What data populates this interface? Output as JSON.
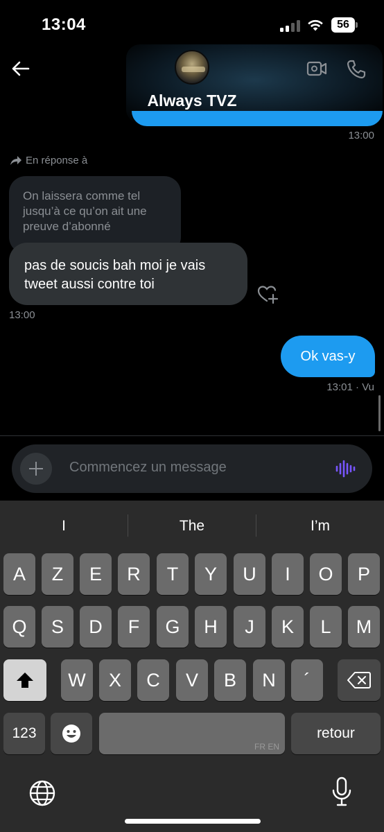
{
  "status_bar": {
    "time": "13:04",
    "battery": "56"
  },
  "header": {
    "contact_name": "Always TVZ"
  },
  "chat": {
    "timestamp_1": "13:00",
    "reply_label": "En réponse à",
    "quoted_text": "On laissera comme tel jusqu’à ce qu’on ait une preuve d’abonné",
    "incoming_text": "pas de soucis bah moi je vais tweet aussi contre toi",
    "timestamp_2": "13:00",
    "outgoing_text": "Ok vas-y",
    "timestamp_3": "13:01 · Vu"
  },
  "composer": {
    "placeholder": "Commencez un message"
  },
  "keyboard": {
    "suggestions": [
      "I",
      "The",
      "I’m"
    ],
    "row1": [
      "A",
      "Z",
      "E",
      "R",
      "T",
      "Y",
      "U",
      "I",
      "O",
      "P"
    ],
    "row2": [
      "Q",
      "S",
      "D",
      "F",
      "G",
      "H",
      "J",
      "K",
      "L",
      "M"
    ],
    "row3": [
      "W",
      "X",
      "C",
      "V",
      "B",
      "N",
      "´"
    ],
    "numbers_key": "123",
    "space_lang": "FR EN",
    "return_key": "retour"
  },
  "colors": {
    "accent": "#1d9bf0",
    "voice_icon": "#7856ff"
  }
}
